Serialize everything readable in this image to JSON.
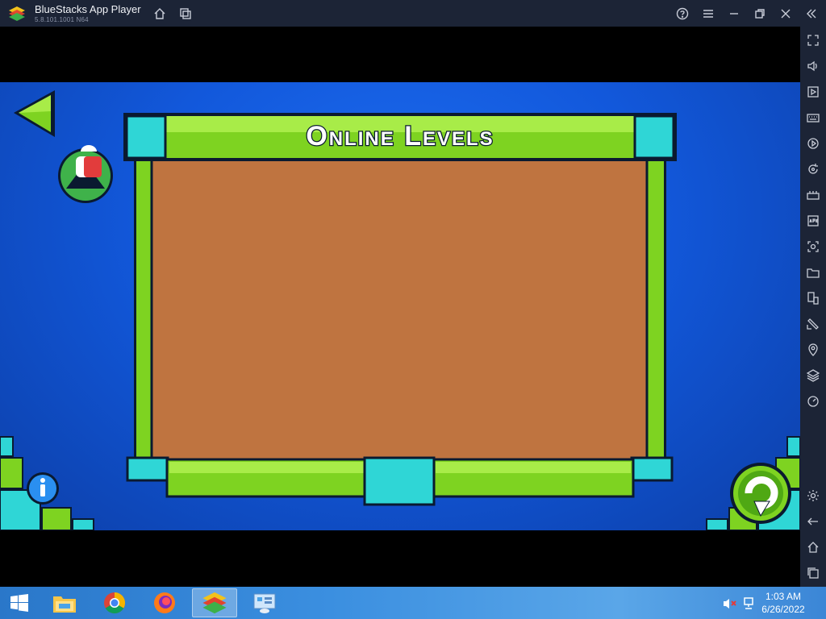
{
  "window": {
    "title": "BlueStacks App Player",
    "version": "5.8.101.1001  N64"
  },
  "titlebar_icons": [
    "home-icon",
    "multi-instance-icon",
    "help-icon",
    "menu-icon",
    "minimize-icon",
    "restore-icon",
    "close-icon",
    "collapse-sidebar-icon"
  ],
  "sidebar_icons": [
    "fullscreen-icon",
    "volume-icon",
    "media-manager-icon",
    "keyboard-controls-icon",
    "macro-recorder-icon",
    "sync-icon",
    "game-controls-icon",
    "install-apk-icon",
    "screenshot-icon",
    "folder-icon",
    "multi-instance-manager-icon",
    "rotate-icon",
    "location-icon",
    "layers-icon",
    "eco-mode-icon",
    "settings-icon",
    "back-icon",
    "android-home-icon",
    "recent-apps-icon"
  ],
  "game": {
    "panel_title": "Online Levels",
    "panel_color": "#bf7440",
    "frame_green": "#7ed321",
    "frame_cyan": "#2fd6d6",
    "background_blue": "#1258db"
  },
  "taskbar": {
    "apps": [
      "file-explorer-icon",
      "chrome-icon",
      "firefox-icon",
      "bluestacks-icon",
      "control-panel-icon"
    ],
    "active_app": "bluestacks-icon",
    "time": "1:03 AM",
    "date": "6/26/2022"
  }
}
